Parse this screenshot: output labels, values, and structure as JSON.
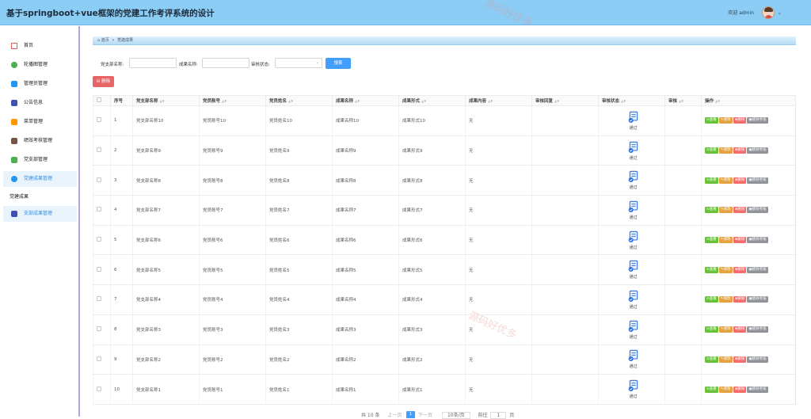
{
  "header": {
    "title": "基于springboot+vue框架的党建工作考评系统的设计",
    "welcome": "欢迎 admin"
  },
  "watermarks": [
    "源码好优多",
    "源码好优多",
    "源码好优多"
  ],
  "sidebar": {
    "items": [
      {
        "label": "首页",
        "icon": "home-icon",
        "color": "#e25b5b"
      },
      {
        "label": "轮播图管理",
        "icon": "image-icon",
        "color": "#4caf50"
      },
      {
        "label": "管理员管理",
        "icon": "admin-icon",
        "color": "#2196f3"
      },
      {
        "label": "公告信息",
        "icon": "notice-icon",
        "color": "#3f51b5"
      },
      {
        "label": "菜单管理",
        "icon": "menu-icon",
        "color": "#ff9800"
      },
      {
        "label": "绩效考核管理",
        "icon": "assessment-icon",
        "color": "#795548"
      },
      {
        "label": "党支部管理",
        "icon": "branch-icon",
        "color": "#4caf50"
      },
      {
        "label": "党建成果管理",
        "icon": "achievement-icon",
        "color": "#2196f3"
      }
    ],
    "group_label": "党建成果",
    "sub_items": [
      {
        "label": "支部成果管理",
        "icon": "sub-admin-icon",
        "color": "#3f51b5"
      }
    ]
  },
  "breadcrumb": {
    "home": "⌂ 首页",
    "sep": "»",
    "current": "党建成果"
  },
  "search": {
    "branch_label": "党支部名称:",
    "result_label": "成果名称:",
    "status_label": "审核状态:",
    "button": "搜索"
  },
  "toolbar": {
    "delete_label": "删除"
  },
  "table": {
    "headers": [
      "序号",
      "党支部名称",
      "党员账号",
      "党员姓名",
      "成果名称",
      "成果形式",
      "成果内容",
      "审核回复",
      "审核状态",
      "审核",
      "操作"
    ],
    "rows": [
      {
        "no": "1",
        "branch": "党支部名称10",
        "account": "党员账号10",
        "name": "党员姓名10",
        "result": "成果名称10",
        "form": "成果形式10",
        "content": "无",
        "status": "通过"
      },
      {
        "no": "2",
        "branch": "党支部名称9",
        "account": "党员账号9",
        "name": "党员姓名9",
        "result": "成果名称9",
        "form": "成果形式9",
        "content": "无",
        "status": "通过"
      },
      {
        "no": "3",
        "branch": "党支部名称8",
        "account": "党员账号8",
        "name": "党员姓名8",
        "result": "成果名称8",
        "form": "成果形式8",
        "content": "无",
        "status": "通过"
      },
      {
        "no": "4",
        "branch": "党支部名称7",
        "account": "党员账号7",
        "name": "党员姓名7",
        "result": "成果名称7",
        "form": "成果形式7",
        "content": "无",
        "status": "通过"
      },
      {
        "no": "5",
        "branch": "党支部名称6",
        "account": "党员账号6",
        "name": "党员姓名6",
        "result": "成果名称6",
        "form": "成果形式6",
        "content": "无",
        "status": "通过"
      },
      {
        "no": "6",
        "branch": "党支部名称5",
        "account": "党员账号5",
        "name": "党员姓名5",
        "result": "成果名称5",
        "form": "成果形式5",
        "content": "无",
        "status": "通过"
      },
      {
        "no": "7",
        "branch": "党支部名称4",
        "account": "党员账号4",
        "name": "党员姓名4",
        "result": "成果名称4",
        "form": "成果形式4",
        "content": "无",
        "status": "通过"
      },
      {
        "no": "8",
        "branch": "党支部名称3",
        "account": "党员账号3",
        "name": "党员姓名3",
        "result": "成果名称3",
        "form": "成果形式3",
        "content": "无",
        "status": "通过"
      },
      {
        "no": "9",
        "branch": "党支部名称2",
        "account": "党员账号2",
        "name": "党员姓名2",
        "result": "成果名称2",
        "form": "成果形式2",
        "content": "无",
        "status": "通过"
      },
      {
        "no": "10",
        "branch": "党支部名称1",
        "account": "党员账号1",
        "name": "党员姓名1",
        "result": "成果名称1",
        "form": "成果形式1",
        "content": "无",
        "status": "通过"
      }
    ],
    "actions": {
      "view": "查看",
      "edit": "修改",
      "delete": "删除",
      "evaluate": "绩效考核"
    }
  },
  "pagination": {
    "total": "共 10 条",
    "prev": "上一页",
    "page": "1",
    "next": "下一页",
    "size": "10条/页",
    "goto": "前往",
    "goto_value": "1",
    "page_suffix": "页"
  }
}
